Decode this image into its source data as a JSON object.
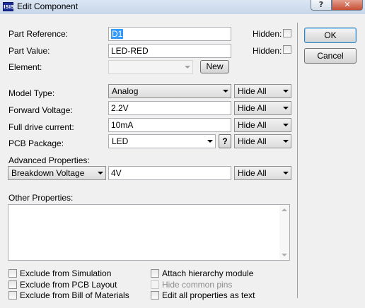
{
  "window": {
    "title": "Edit Component",
    "icon_text": "ISIS",
    "help_glyph": "?",
    "close_glyph": "✕"
  },
  "part_reference": {
    "label": "Part Reference:",
    "value": "D1",
    "hidden_label": "Hidden:"
  },
  "part_value": {
    "label": "Part Value:",
    "value": "LED-RED",
    "hidden_label": "Hidden:"
  },
  "element": {
    "label": "Element:",
    "value": "",
    "new_label": "New"
  },
  "buttons": {
    "ok": "OK",
    "cancel": "Cancel"
  },
  "model_type": {
    "label": "Model Type:",
    "value": "Analog",
    "visibility": "Hide All"
  },
  "forward_voltage": {
    "label": "Forward Voltage:",
    "value": "2.2V",
    "visibility": "Hide All"
  },
  "full_drive_current": {
    "label": "Full drive current:",
    "value": "10mA",
    "visibility": "Hide All"
  },
  "pcb_package": {
    "label": "PCB Package:",
    "value": "LED",
    "help": "?",
    "visibility": "Hide All"
  },
  "advanced": {
    "label": "Advanced Properties:",
    "property": "Breakdown Voltage",
    "value": "4V",
    "visibility": "Hide All"
  },
  "other_properties": {
    "label": "Other Properties:",
    "value": ""
  },
  "options": {
    "exclude_simulation": "Exclude from Simulation",
    "exclude_pcb": "Exclude from PCB Layout",
    "exclude_bom": "Exclude from Bill of Materials",
    "attach_hierarchy": "Attach hierarchy module",
    "hide_common_pins": "Hide common pins",
    "edit_as_text": "Edit all properties as text"
  }
}
